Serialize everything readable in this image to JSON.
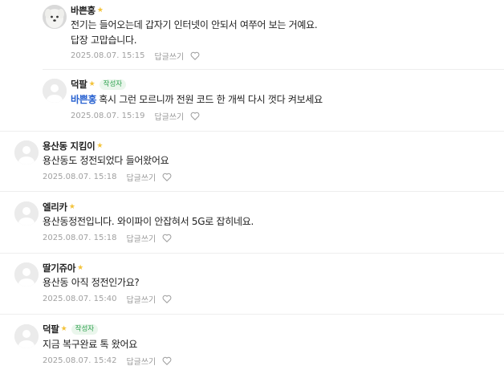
{
  "comments": [
    {
      "author": "바쁜홍",
      "badge": "",
      "mention": "",
      "lines": [
        "전기는 들어오는데 갑자기 인터넷이 안되서 여쭈어 보는 거예요.",
        "답장 고맙습니다."
      ],
      "date": "2025.08.07. 15:15",
      "reply_label": "답글쓰기",
      "avatar": "dog-photo"
    },
    {
      "author": "덕팔",
      "badge": "작성자",
      "mention": "바쁜홍",
      "lines": [
        "혹시 그런 모르니까 전원 코드 한 개씩 다시 껏다 켜보세요"
      ],
      "date": "2025.08.07. 15:19",
      "reply_label": "답글쓰기",
      "avatar": "default-avatar"
    },
    {
      "author": "용산동 지킴이",
      "badge": "",
      "mention": "",
      "lines": [
        "용산동도 정전되었다 들어왔어요"
      ],
      "date": "2025.08.07. 15:18",
      "reply_label": "답글쓰기",
      "avatar": "default-avatar"
    },
    {
      "author": "엘리카",
      "badge": "",
      "mention": "",
      "lines": [
        "용산동정전입니다. 와이파이 안잡혀서 5G로 잡히네요."
      ],
      "date": "2025.08.07. 15:18",
      "reply_label": "답글쓰기",
      "avatar": "default-avatar"
    },
    {
      "author": "딸기쥬아",
      "badge": "",
      "mention": "",
      "lines": [
        "용산동 아직 정전인가요?"
      ],
      "date": "2025.08.07. 15:40",
      "reply_label": "답글쓰기",
      "avatar": "default-avatar"
    },
    {
      "author": "덕팔",
      "badge": "작성자",
      "mention": "",
      "lines": [
        "지금 복구완료 톡 왔어요"
      ],
      "date": "2025.08.07. 15:42",
      "reply_label": "답글쓰기",
      "avatar": "default-avatar"
    }
  ],
  "colors": {
    "mention": "#2a63d1",
    "badge_text": "#2fa24f",
    "badge_bg": "#eaf6ec",
    "star": "#f3c33b",
    "meta": "#a0a0a0"
  },
  "icons": {
    "star": "star-icon",
    "like": "heart-icon"
  }
}
